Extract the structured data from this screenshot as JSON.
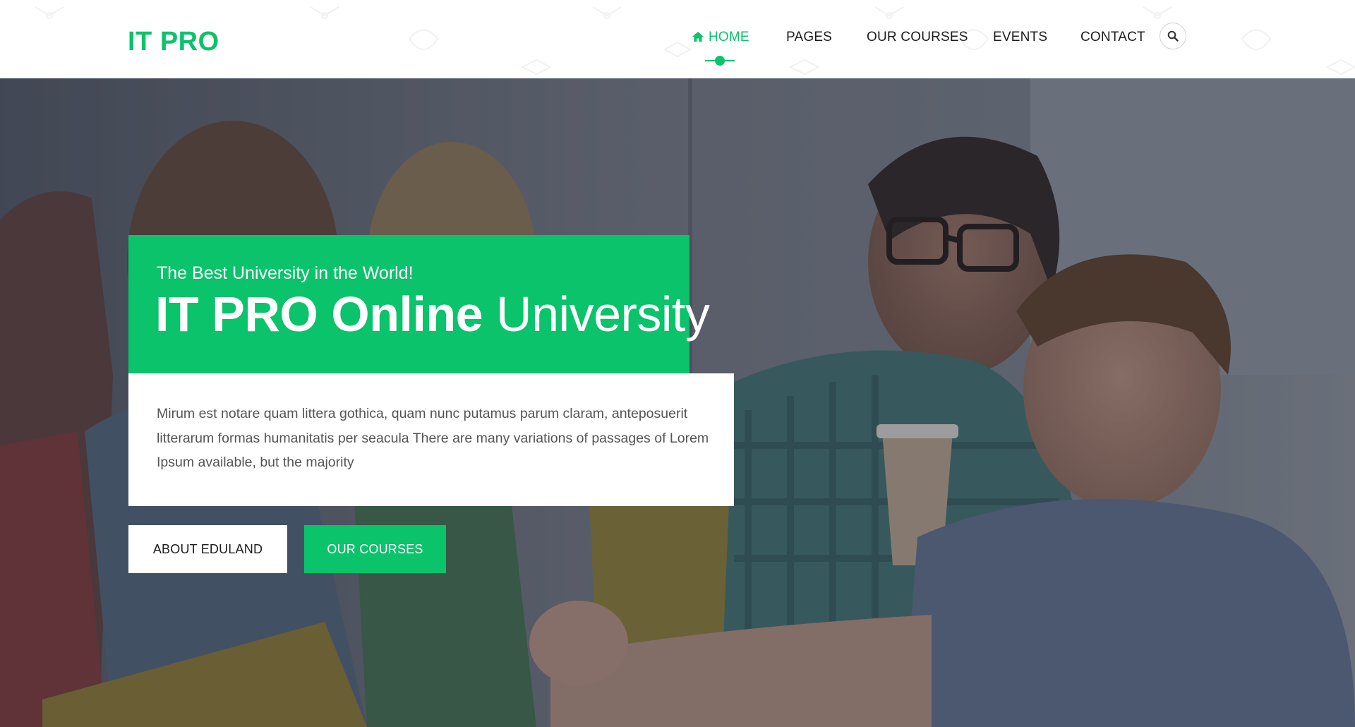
{
  "header": {
    "logo": "IT PRO",
    "nav": [
      {
        "label": "HOME",
        "active": true,
        "icon": "home-icon"
      },
      {
        "label": "PAGES"
      },
      {
        "label": "OUR COURSES"
      },
      {
        "label": "EVENTS"
      },
      {
        "label": "CONTACT"
      }
    ],
    "search_icon": "search-icon"
  },
  "hero": {
    "subtitle": "The Best University in the World!",
    "title_bold": "IT PRO Online",
    "title_light": "University",
    "description": "Mirum est notare quam littera gothica, quam nunc putamus parum claram, anteposuerit litterarum formas humanitatis per seacula There are many variations of passages of Lorem Ipsum available, but the majority",
    "buttons": {
      "about": "ABOUT EDULAND",
      "courses": "OUR COURSES"
    }
  },
  "colors": {
    "accent": "#0ac36a",
    "text_dark": "#1c1c1c",
    "text_body": "#555555",
    "overlay": "#5d6470"
  }
}
